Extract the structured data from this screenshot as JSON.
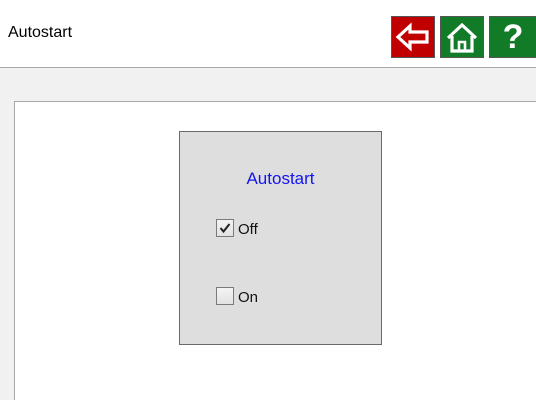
{
  "header": {
    "title": "Autostart",
    "buttons": [
      {
        "name": "back",
        "icon": "arrow-left-icon",
        "color": "#c00000"
      },
      {
        "name": "home",
        "icon": "home-icon",
        "color": "#127b27"
      },
      {
        "name": "help",
        "icon": "question-icon",
        "label": "?",
        "color": "#127b27"
      }
    ]
  },
  "group": {
    "title": "Autostart",
    "title_color": "#1414ee",
    "options": [
      {
        "label": "Off",
        "checked": true
      },
      {
        "label": "On",
        "checked": false
      }
    ]
  }
}
